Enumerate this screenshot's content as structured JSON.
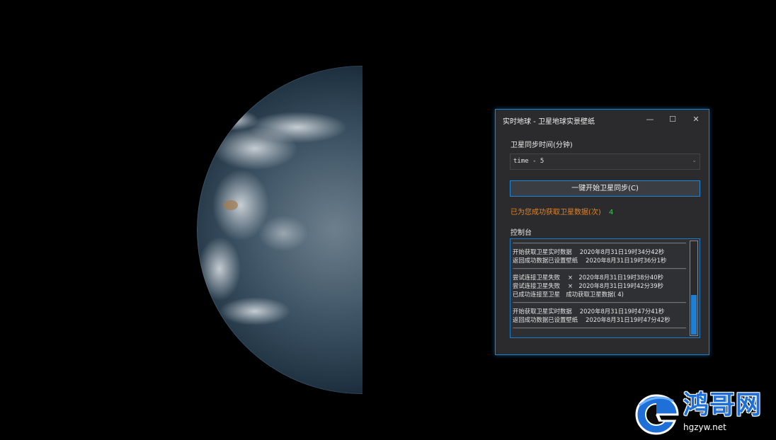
{
  "window": {
    "title": "实时地球 - 卫星地球实景壁纸",
    "minimize_glyph": "—",
    "maximize_glyph": "☐",
    "close_glyph": "✕"
  },
  "sync": {
    "label": "卫星同步时间(分钟)",
    "selected_value": "time - 5",
    "button_label": "一键开始卫星同步(C)"
  },
  "status": {
    "label": "已为您成功获取卫星数据(次)",
    "count": "4",
    "label_color": "#e8821e",
    "count_color": "#35c94a"
  },
  "console": {
    "label": "控制台",
    "lines": [
      "———————————————————————————————————",
      "开始获取卫星实时数据　  2020年8月31日19时34分42秒",
      "返回成功数据已设置壁纸　   2020年8月31日19时36分1秒",
      "———————————————————————————————————",
      "尝试连接卫星失败　 ×　2020年8月31日19时38分40秒",
      "尝试连接卫星失败　 ×　2020年8月31日19时42分39秒",
      "已成功连接至卫星　成功获取卫星数据( 4)",
      "———————————————————————————————————",
      "开始获取卫星实时数据　  2020年8月31日19时47分41秒",
      "返回成功数据已设置壁纸　   2020年8月31日19时47分42秒",
      "———————————————————————————————————"
    ]
  },
  "watermark": {
    "brand": "鸿哥网",
    "url": "hgzyw.net"
  },
  "colors": {
    "accent": "#1e86d6",
    "window_bg": "#2b2b2d",
    "background": "#000000"
  },
  "icons": {
    "minimize": "minimize-icon",
    "maximize": "maximize-icon",
    "close": "close-icon",
    "dropdown": "chevron-down-icon"
  }
}
